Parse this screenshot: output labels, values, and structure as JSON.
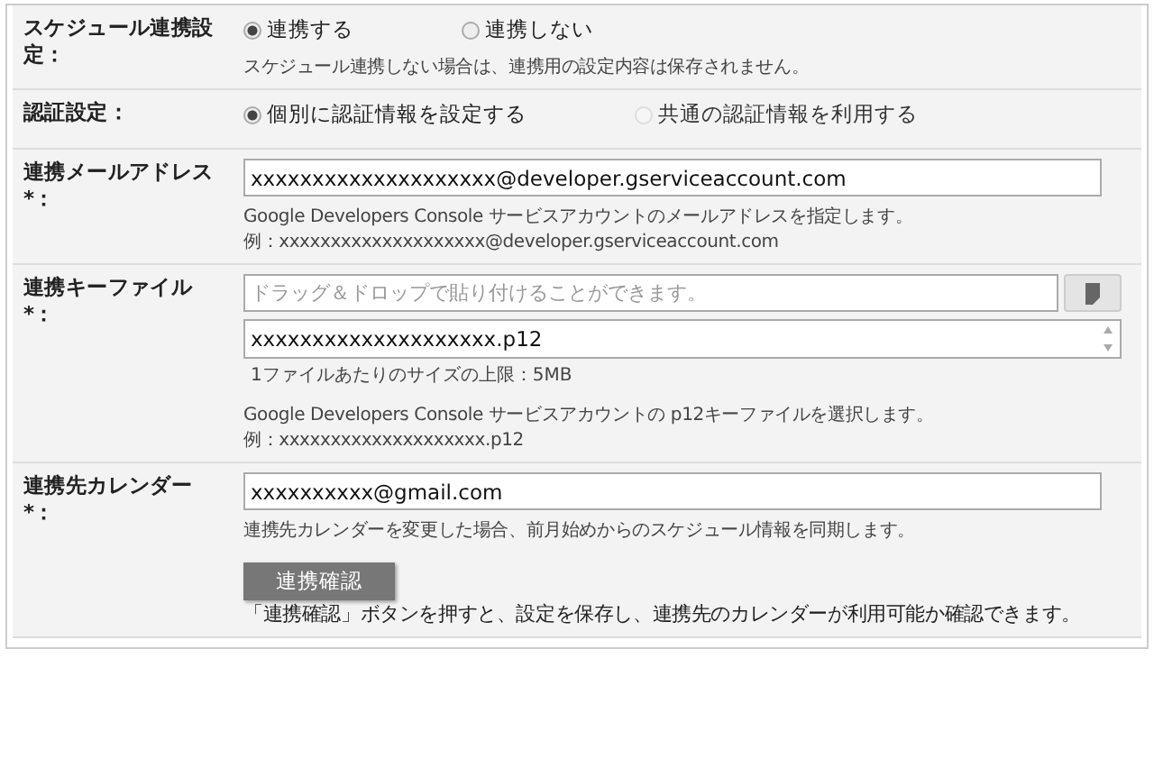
{
  "rows": [
    {
      "label": "スケジュール連携設定：",
      "parts": [
        {
          "kind": "radios",
          "options": [
            {
              "label": "連携する",
              "selected": true,
              "disabled": false
            },
            {
              "label": "連携しない",
              "selected": false,
              "disabled": false
            }
          ]
        },
        {
          "kind": "note",
          "text": "スケジュール連携しない場合は、連携用の設定内容は保存されません。"
        }
      ]
    },
    {
      "label": "認証設定：",
      "parts": [
        {
          "kind": "radios",
          "options": [
            {
              "label": "個別に認証情報を設定する",
              "selected": true,
              "disabled": false
            },
            {
              "label": "共通の認証情報を利用する",
              "selected": false,
              "disabled": true
            }
          ]
        }
      ]
    },
    {
      "label": "連携メールアドレス",
      "mark": "*：",
      "parts": [
        {
          "kind": "input",
          "value": "xxxxxxxxxxxxxxxxxxxx@developer.gserviceaccount.com"
        },
        {
          "kind": "note",
          "text": "Google Developers Console サービスアカウントのメールアドレスを指定します。"
        },
        {
          "kind": "example",
          "text": "例：xxxxxxxxxxxxxxxxxxxx@developer.gserviceaccount.com"
        }
      ]
    },
    {
      "label": "連携キーファイル",
      "mark": "*：",
      "parts": [
        {
          "kind": "dropzone",
          "placeholder": "ドラッグ＆ドロップで貼り付けることができます。"
        },
        {
          "kind": "file",
          "value": "xxxxxxxxxxxxxxxxxxxx.p12"
        },
        {
          "kind": "limit",
          "text": "1ファイルあたりのサイズの上限：5MB"
        },
        {
          "kind": "note",
          "text": "Google Developers Console サービスアカウントの p12キーファイルを選択します。"
        },
        {
          "kind": "example",
          "text": "例：xxxxxxxxxxxxxxxxxxxx.p12"
        }
      ]
    },
    {
      "label": "連携先カレンダー",
      "mark": "*：",
      "parts": [
        {
          "kind": "input",
          "value": "xxxxxxxxxx@gmail.com"
        },
        {
          "kind": "note",
          "text": "連携先カレンダーを変更した場合、前月始めからのスケジュール情報を同期します。"
        },
        {
          "kind": "button",
          "label": "連携確認"
        },
        {
          "kind": "body",
          "text": "「連携確認」ボタンを押すと、設定を保存し、連携先のカレンダーが利用可能か確認できます。"
        }
      ]
    }
  ]
}
